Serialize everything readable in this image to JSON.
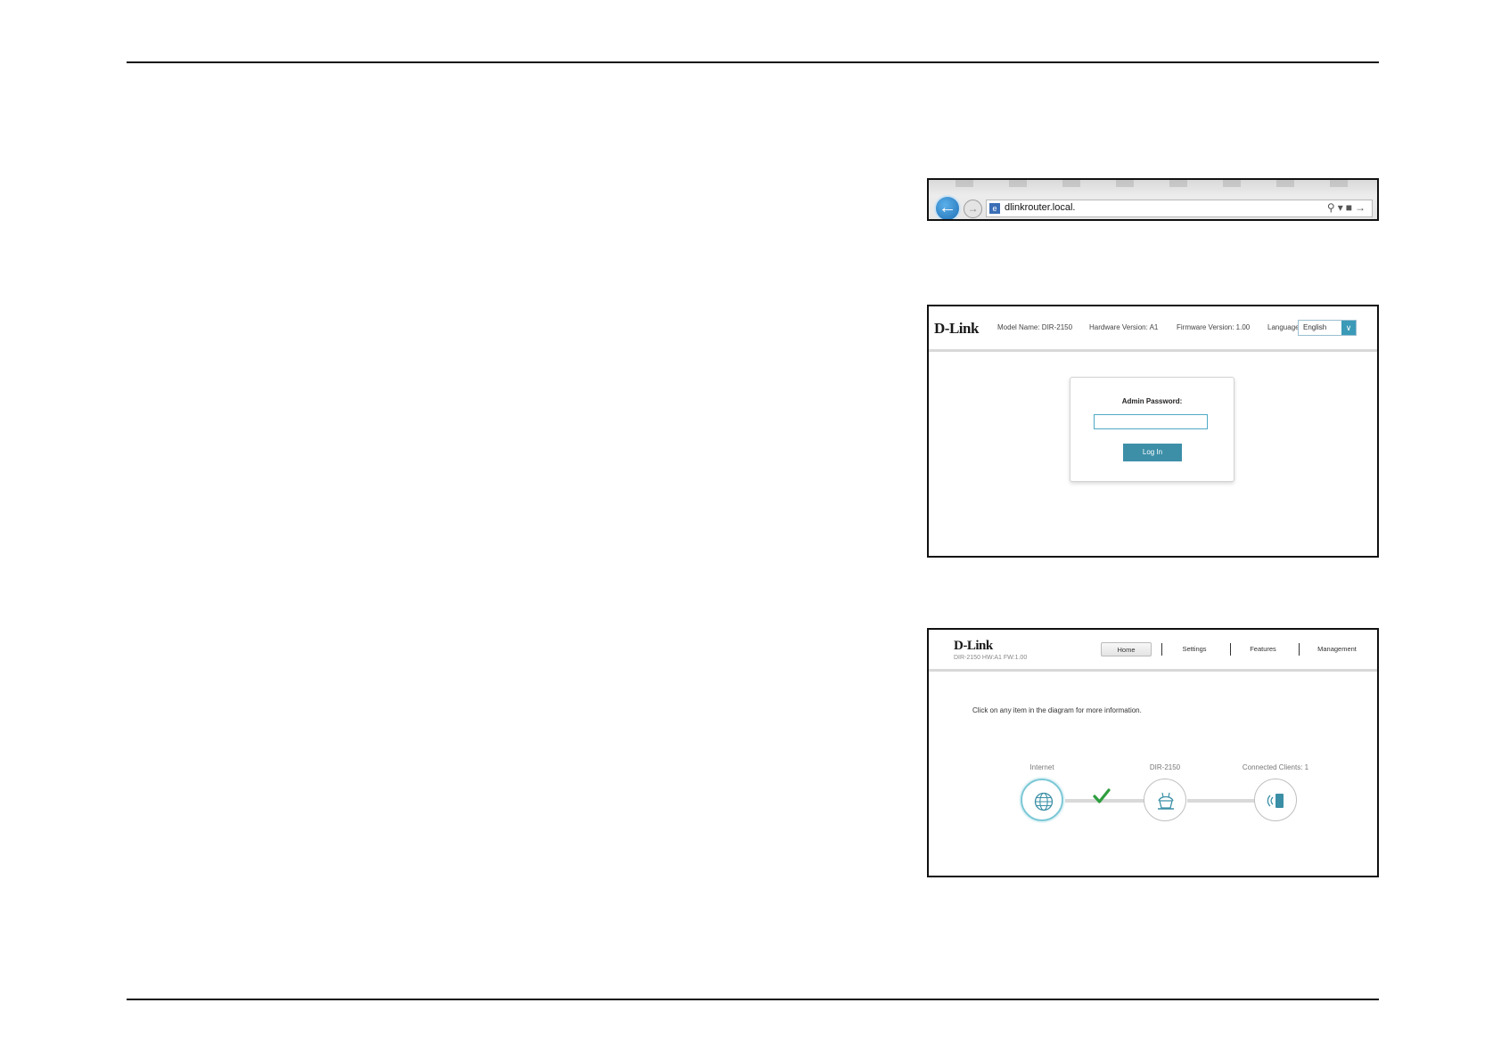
{
  "browser": {
    "url": "dlinkrouter.local."
  },
  "login_page": {
    "logo": "D-Link",
    "model_name": "Model Name: DIR-2150",
    "hardware_version": "Hardware Version: A1",
    "firmware_version": "Firmware Version: 1.00",
    "language_label": "Language",
    "language_value": "English",
    "password_label": "Admin Password:",
    "password_value": "",
    "login_button": "Log In"
  },
  "home_page": {
    "logo": "D-Link",
    "device_info": "DIR-2150 HW:A1 FW:1.00",
    "tabs": [
      {
        "label": "Home",
        "active": true
      },
      {
        "label": "Settings",
        "active": false
      },
      {
        "label": "Features",
        "active": false
      },
      {
        "label": "Management",
        "active": false
      }
    ],
    "info_text": "Click on any item in the diagram for more information.",
    "nodes": [
      {
        "label": "Internet",
        "icon": "globe-icon"
      },
      {
        "label": "DIR-2150",
        "icon": "router-icon"
      },
      {
        "label": "Connected Clients: 1",
        "icon": "mobile-device-icon"
      }
    ],
    "connection_status_icon": "checkmark-icon",
    "colors": {
      "accent": "#3d8fa8",
      "check": "#2e9e3e"
    }
  }
}
